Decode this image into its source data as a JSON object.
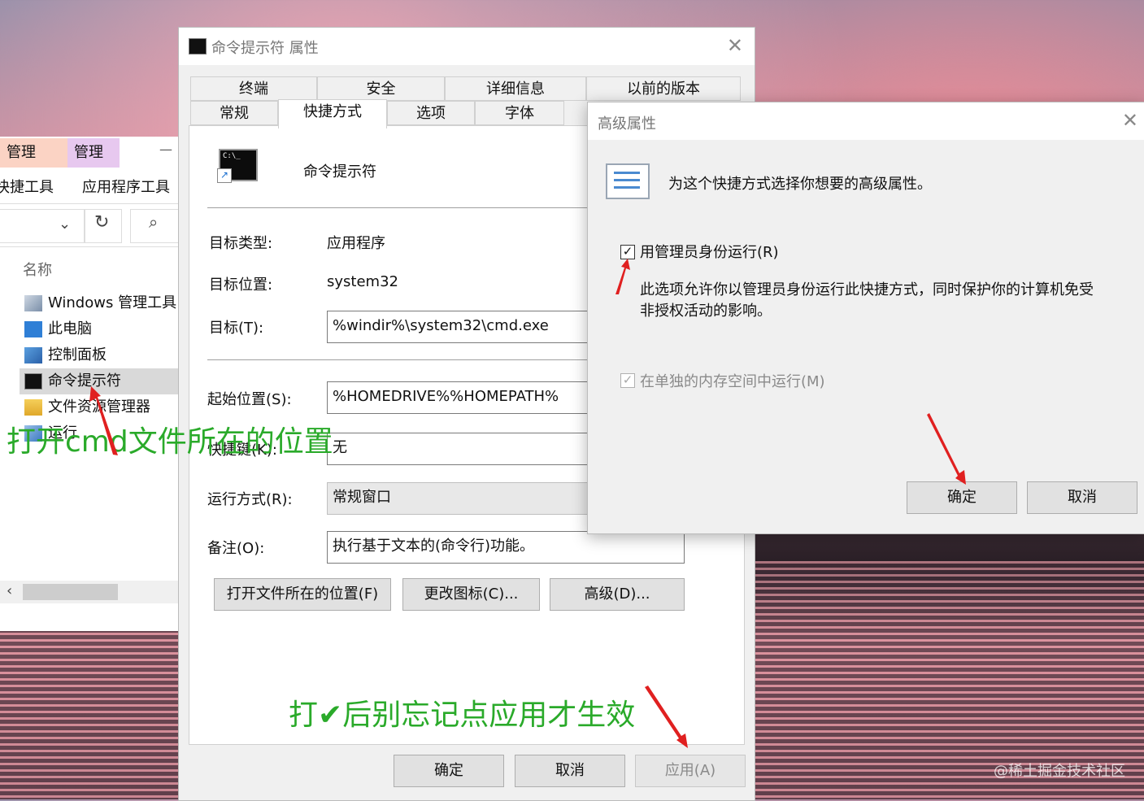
{
  "explorer": {
    "ribbon_tabs": [
      "管理",
      "管理"
    ],
    "ribbon_groups": [
      "快捷工具",
      "应用程序工具"
    ],
    "column_header": "名称",
    "items": [
      {
        "label": "Windows 管理工具",
        "icon": "admin-tools-icon"
      },
      {
        "label": "此电脑",
        "icon": "this-pc-icon"
      },
      {
        "label": "控制面板",
        "icon": "control-panel-icon"
      },
      {
        "label": "命令提示符",
        "icon": "cmd-icon"
      },
      {
        "label": "文件资源管理器",
        "icon": "folder-icon"
      },
      {
        "label": "运行",
        "icon": "run-icon"
      }
    ]
  },
  "props": {
    "title": "命令提示符 属性",
    "tabs_row1": [
      "终端",
      "安全",
      "详细信息",
      "以前的版本"
    ],
    "tabs_row2": [
      "常规",
      "快捷方式",
      "选项",
      "字体"
    ],
    "active_tab": "快捷方式",
    "shortcut_name": "命令提示符",
    "target_type_label": "目标类型:",
    "target_type": "应用程序",
    "target_location_label": "目标位置:",
    "target_location": "system32",
    "target_label": "目标(T):",
    "target": "%windir%\\system32\\cmd.exe",
    "start_in_label": "起始位置(S):",
    "start_in": "%HOMEDRIVE%%HOMEPATH%",
    "hotkey_label": "快捷键(K):",
    "hotkey": "无",
    "run_label": "运行方式(R):",
    "run": "常规窗口",
    "comment_label": "备注(O):",
    "comment": "执行基于文本的(命令行)功能。",
    "open_location_button": "打开文件所在的位置(F)",
    "change_icon_button": "更改图标(C)...",
    "advanced_button": "高级(D)...",
    "ok_button": "确定",
    "cancel_button": "取消",
    "apply_button": "应用(A)"
  },
  "advanced": {
    "title": "高级属性",
    "header": "为这个快捷方式选择你想要的高级属性。",
    "run_as_admin_label": "用管理员身份运行(R)",
    "run_as_admin_checked": true,
    "run_as_admin_note": "此选项允许你以管理员身份运行此快捷方式，同时保护你的计算机免受非授权活动的影响。",
    "separate_memory_label": "在单独的内存空间中运行(M)",
    "separate_memory_checked": true,
    "separate_memory_disabled": true,
    "ok_button": "确定",
    "cancel_button": "取消"
  },
  "annotations": {
    "open_location_note": "打开cmd文件所在的位置",
    "apply_note_prefix": "打",
    "apply_note_mark": "✔",
    "apply_note_suffix": "后别忘记点应用才生效",
    "annotation_color": "#2aaa2a",
    "arrow_color": "#e02020"
  },
  "watermark": "@稀土掘金技术社区"
}
